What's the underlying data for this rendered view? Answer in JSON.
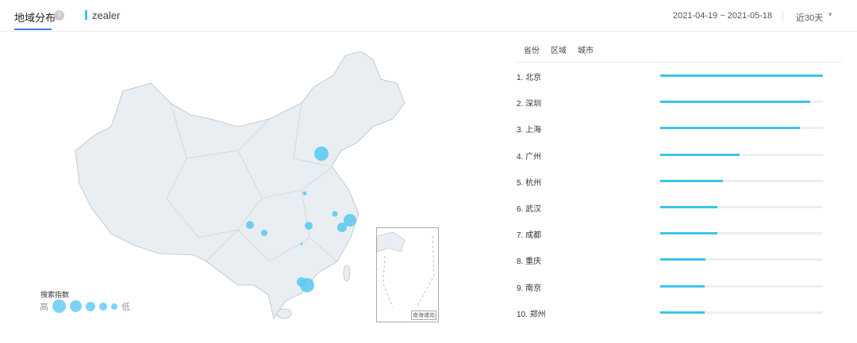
{
  "header": {
    "title": "地域分布",
    "help_icon": "?",
    "keyword": "zealer",
    "date_range": "2021-04-19 ~ 2021-05-18",
    "period": "近30天",
    "caret": "▾"
  },
  "legend": {
    "title": "搜索指数",
    "high": "高",
    "low": "低"
  },
  "inset_label": "南海诸岛",
  "tabs": [
    "省份",
    "区域",
    "城市"
  ],
  "ranking": [
    {
      "label": "1.  北京",
      "value": 1.0
    },
    {
      "label": "2.  深圳",
      "value": 0.92
    },
    {
      "label": "3.  上海",
      "value": 0.86
    },
    {
      "label": "4.  广州",
      "value": 0.49
    },
    {
      "label": "5.  杭州",
      "value": 0.385
    },
    {
      "label": "6.  武汉",
      "value": 0.35
    },
    {
      "label": "7.  成都",
      "value": 0.35
    },
    {
      "label": "8.  重庆",
      "value": 0.28
    },
    {
      "label": "9.  南京",
      "value": 0.275
    },
    {
      "label": "10. 郑州",
      "value": 0.275
    }
  ],
  "colors": {
    "accent": "#3cc4ee",
    "bubble": "#7dd3f5",
    "tab_underline": "#3b7fe0"
  }
}
